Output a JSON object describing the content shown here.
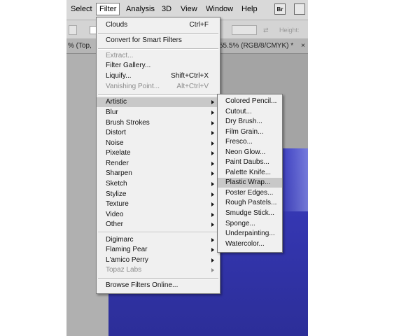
{
  "menubar": {
    "items": [
      "Select",
      "Filter",
      "Analysis",
      "3D",
      "View",
      "Window",
      "Help"
    ],
    "bridge_label": "Br"
  },
  "options_bar": {
    "height_label": "Height:"
  },
  "tabs": {
    "left_tab": "% (Top,",
    "right_tab": "55.5% (RGB/8/CMYK) *",
    "close_glyph": "×"
  },
  "filter_menu": {
    "items": [
      {
        "label": "Clouds",
        "shortcut": "Ctrl+F",
        "disabled": false
      },
      {
        "label": "Convert for Smart Filters",
        "shortcut": "",
        "disabled": false
      },
      {
        "label": "Extract...",
        "shortcut": "",
        "disabled": true
      },
      {
        "label": "Filter Gallery...",
        "shortcut": "",
        "disabled": false
      },
      {
        "label": "Liquify...",
        "shortcut": "Shift+Ctrl+X",
        "disabled": false
      },
      {
        "label": "Vanishing Point...",
        "shortcut": "Alt+Ctrl+V",
        "disabled": true
      },
      {
        "label": "Artistic",
        "submenu": true,
        "highlighted": true
      },
      {
        "label": "Blur",
        "submenu": true
      },
      {
        "label": "Brush Strokes",
        "submenu": true
      },
      {
        "label": "Distort",
        "submenu": true
      },
      {
        "label": "Noise",
        "submenu": true
      },
      {
        "label": "Pixelate",
        "submenu": true
      },
      {
        "label": "Render",
        "submenu": true
      },
      {
        "label": "Sharpen",
        "submenu": true
      },
      {
        "label": "Sketch",
        "submenu": true
      },
      {
        "label": "Stylize",
        "submenu": true
      },
      {
        "label": "Texture",
        "submenu": true
      },
      {
        "label": "Video",
        "submenu": true
      },
      {
        "label": "Other",
        "submenu": true
      },
      {
        "label": "Digimarc",
        "submenu": true
      },
      {
        "label": "Flaming Pear",
        "submenu": true
      },
      {
        "label": "L'amico Perry",
        "submenu": true
      },
      {
        "label": "Topaz Labs",
        "submenu": true,
        "disabled": true
      },
      {
        "label": "Browse Filters Online...",
        "shortcut": ""
      }
    ]
  },
  "artistic_submenu": {
    "items": [
      "Colored Pencil...",
      "Cutout...",
      "Dry Brush...",
      "Film Grain...",
      "Fresco...",
      "Neon Glow...",
      "Paint Daubs...",
      "Palette Knife...",
      "Plastic Wrap...",
      "Poster Edges...",
      "Rough Pastels...",
      "Smudge Stick...",
      "Sponge...",
      "Underpainting...",
      "Watercolor..."
    ],
    "highlighted": "Plastic Wrap..."
  },
  "colors": {
    "menu_bg": "#f0f0f0",
    "highlight": "#c8c8c8",
    "document_blue": "#3436b0"
  }
}
